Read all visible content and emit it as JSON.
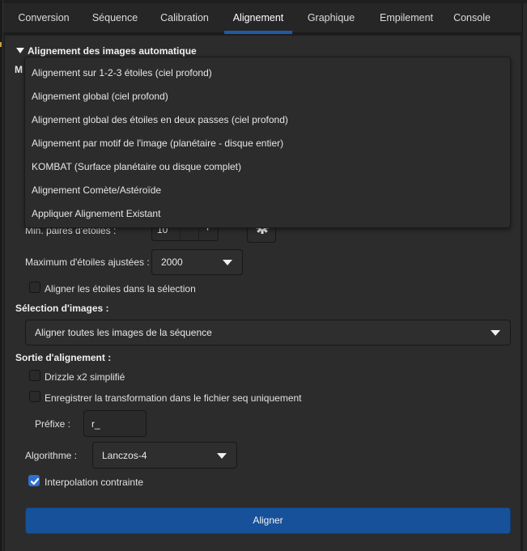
{
  "tabs": [
    {
      "label": "Conversion",
      "active": false
    },
    {
      "label": "Séquence",
      "active": false
    },
    {
      "label": "Calibration",
      "active": false
    },
    {
      "label": "Alignement",
      "active": true
    },
    {
      "label": "Graphique",
      "active": false
    },
    {
      "label": "Empilement",
      "active": false
    },
    {
      "label": "Console",
      "active": false
    }
  ],
  "section": {
    "title": "Alignement des images automatique",
    "method_label_partial": "M"
  },
  "method_dropdown": {
    "options": [
      "Alignement sur 1-2-3 étoiles (ciel profond)",
      "Alignement global (ciel profond)",
      "Alignement global des étoiles en deux passes (ciel profond)",
      "Alignement par motif de l'image (planétaire - disque entier)",
      "KOMBAT (Surface planétaire ou disque complet)",
      "Alignement Comète/Astéroïde",
      "Appliquer Alignement Existant"
    ]
  },
  "star_options": {
    "min_pairs_label": "Min. paires d'étoiles :",
    "min_pairs_value": "10",
    "minus_glyph": "−",
    "plus_glyph": "+",
    "max_stars_label": "Maximum d'étoiles ajustées :",
    "max_stars_value": "2000",
    "align_in_selection_label": "Aligner les étoiles dans la sélection",
    "align_in_selection_checked": false
  },
  "image_selection": {
    "label": "Sélection d'images :",
    "value": "Aligner toutes les images de la séquence"
  },
  "output": {
    "label": "Sortie d'alignement :",
    "drizzle_label": "Drizzle x2 simplifié",
    "drizzle_checked": false,
    "save_transform_label": "Enregistrer la transformation dans le fichier seq uniquement",
    "save_transform_checked": false,
    "prefix_label": "Préfixe :",
    "prefix_value": "r_",
    "algorithm_label": "Algorithme :",
    "algorithm_value": "Lanczos-4",
    "clamp_label": "Interpolation contrainte",
    "clamp_checked": true
  },
  "actions": {
    "align_button": "Aligner"
  },
  "colors": {
    "accent": "#17519a",
    "tab_indicator": "#1f5aa6",
    "checkbox_checked": "#2f6fcf",
    "panel_bg": "#2c2c2c"
  }
}
